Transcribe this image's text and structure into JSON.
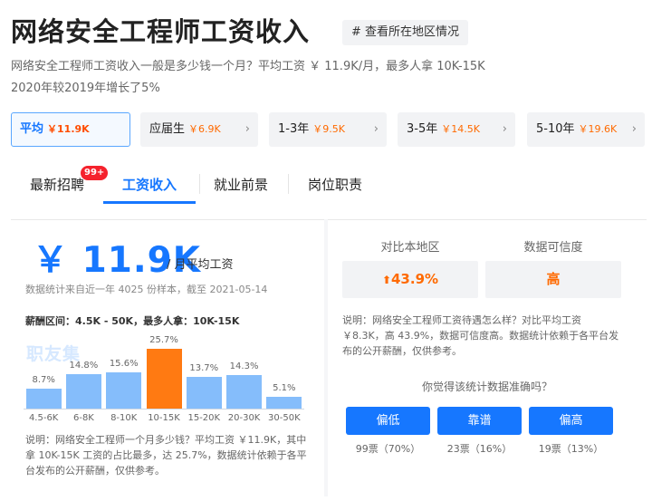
{
  "header": {
    "title": "网络安全工程师工资收入",
    "region_tag": "# 查看所在地区情况"
  },
  "intro": {
    "line1": "网络安全工程师工资收入一般是多少钱一个月？平均工资 ￥ 11.9K/月，最多人拿 10K-15K",
    "line2": "2020年较2019年增长了5%"
  },
  "levels": [
    {
      "name": "平均",
      "value": "￥11.9K",
      "active": true
    },
    {
      "name": "应届生",
      "value": "￥6.9K"
    },
    {
      "name": "1-3年",
      "value": "￥9.5K"
    },
    {
      "name": "3-5年",
      "value": "￥14.5K"
    },
    {
      "name": "5-10年",
      "value": "￥19.6K"
    }
  ],
  "tabs": [
    {
      "label": "最新招聘",
      "badge": "99+"
    },
    {
      "label": "工资收入",
      "active": true
    },
    {
      "label": "就业前景"
    },
    {
      "label": "岗位职责"
    }
  ],
  "summary": {
    "salary": "￥ 11.9K",
    "salary_unit": "/ 月平均工资",
    "stat_note": "数据统计来自近一年 4025 份样本，截至 2021-05-14",
    "range_note": "薪酬区间：4.5K - 50K，最多人拿：10K-15K",
    "watermark": "职友集"
  },
  "chart_data": {
    "type": "bar",
    "categories": [
      "4.5-6K",
      "6-8K",
      "8-10K",
      "10-15K",
      "15-20K",
      "20-30K",
      "30-50K"
    ],
    "values": [
      8.7,
      14.8,
      15.6,
      25.7,
      13.7,
      14.3,
      5.1
    ],
    "labels": [
      "8.7%",
      "14.8%",
      "15.6%",
      "25.7%",
      "13.7%",
      "14.3%",
      "5.1%"
    ],
    "highlight_index": 3,
    "colors": {
      "bar": "#85bdfb",
      "highlight": "#ff7a12"
    },
    "ylim": [
      0,
      25.7
    ],
    "grid": false
  },
  "left_description": "说明：网络安全工程师一个月多少钱？平均工资 ￥11.9K，其中拿 10K-15K 工资的占比最多，达 25.7%，数据统计依赖于各平台发布的公开薪酬，仅供参考。",
  "comparison": {
    "local_header": "对比本地区",
    "local_value": "43.9%",
    "credibility_header": "数据可信度",
    "credibility_value": "高"
  },
  "right_description": "说明：网络安全工程师工资待遇怎么样？对比平均工资 ￥8.3K，高 43.9%，数据可信度高。数据统计依赖于各平台发布的公开薪酬，仅供参考。",
  "vote": {
    "question": "你觉得该统计数据准确吗？",
    "options": [
      {
        "label": "偏低",
        "count": "99票（70%）"
      },
      {
        "label": "靠谱",
        "count": "23票（16%）"
      },
      {
        "label": "偏高",
        "count": "19票（13%）"
      }
    ]
  },
  "colors": {
    "accent": "#1677ff",
    "orange": "#ff6a00"
  }
}
